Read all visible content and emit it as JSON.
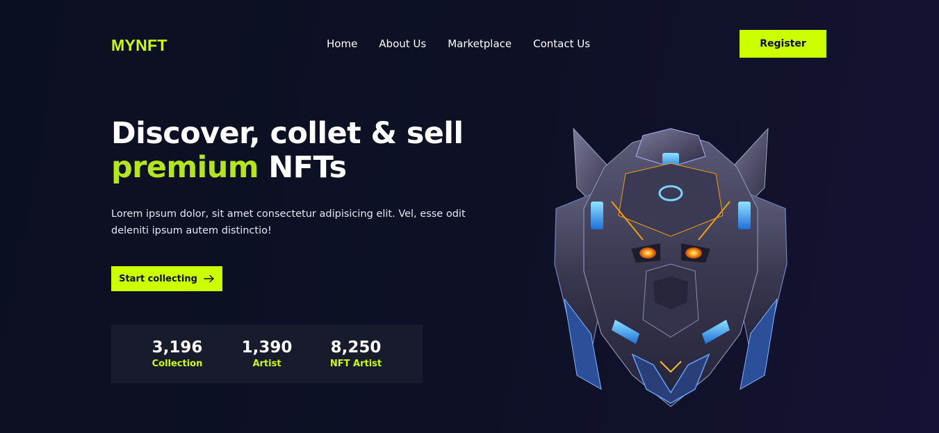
{
  "colors": {
    "accent": "#ccff00",
    "accent_text": "#b5e61d",
    "background": "#0e1126",
    "stats_bg": "#171b2b"
  },
  "header": {
    "logo": "MYNFT",
    "nav": [
      {
        "label": "Home"
      },
      {
        "label": "About Us"
      },
      {
        "label": "Marketplace"
      },
      {
        "label": "Contact Us"
      }
    ],
    "register_label": "Register"
  },
  "hero": {
    "title_line1": "Discover, collet & sell",
    "title_highlight": "premium",
    "title_rest": "NFTs",
    "description": "Lorem ipsum dolor, sit amet consectetur adipisicing elit. Vel, esse odit deleniti ipsum autem distinctio!",
    "cta_label": "Start collecting",
    "cta_icon": "arrow-right-icon",
    "image_icon": "robot-helmet-nft-image"
  },
  "stats": [
    {
      "value": "3,196",
      "label": "Collection"
    },
    {
      "value": "1,390",
      "label": "Artist"
    },
    {
      "value": "8,250",
      "label": "NFT Artist"
    }
  ]
}
